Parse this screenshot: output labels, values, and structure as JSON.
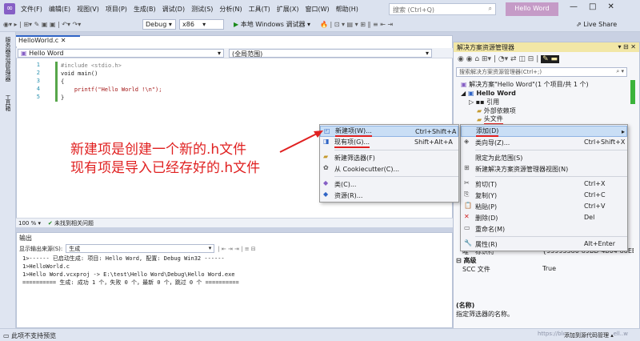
{
  "menu": [
    "文件(F)",
    "编辑(E)",
    "视图(V)",
    "项目(P)",
    "生成(B)",
    "调试(D)",
    "测试(S)",
    "分析(N)",
    "工具(T)",
    "扩展(X)",
    "窗口(W)",
    "帮助(H)"
  ],
  "search_placeholder": "搜索 (Ctrl+Q)",
  "app_title": "Hello Word",
  "live_share": "Live Share",
  "toolbar": {
    "config": "Debug",
    "platform": "x86",
    "run": "本地 Windows 调试器"
  },
  "left_strip": [
    "服务器资源管理器",
    "工具箱"
  ],
  "editor": {
    "tab": "HelloWorld.c",
    "scope_left": "Hello Word",
    "scope_right": "(全局范围)",
    "lines": [
      {
        "n": "1",
        "t": "#include <stdio.h>"
      },
      {
        "n": "2",
        "t": "void main()"
      },
      {
        "n": "3",
        "t": "{"
      },
      {
        "n": "4",
        "t": "    printf(\"Hello World !\\n\");"
      },
      {
        "n": "5",
        "t": "}"
      }
    ],
    "zoom": "100 %",
    "issues": "未找到相关问题"
  },
  "output": {
    "title": "输出",
    "source_label": "显示输出来源(S):",
    "source": "生成",
    "lines": [
      "1>------ 已启动生成: 项目: Hello Word, 配置: Debug Win32 ------",
      "1>HelloWorld.c",
      "1>Hello Word.vcxproj -> E:\\test\\Hello Word\\Debug\\Hello Word.exe",
      "========== 生成: 成功 1 个，失败 0 个，最新 0 个，跳过 0 个 =========="
    ]
  },
  "solution_explorer": {
    "title": "解决方案资源管理器",
    "search": "搜索解决方案资源管理器(Ctrl+;)",
    "items": [
      "解决方案\"Hello Word\"(1 个项目/共 1 个)",
      "Hello Word",
      "引用",
      "外部依赖项",
      "头文件"
    ]
  },
  "properties": {
    "rows": [
      {
        "k": "唯一标识符",
        "v": "{93995380-89BD-4b04-88EB-6"
      }
    ],
    "group": "高级",
    "scc_key": "SCC 文件",
    "scc_val": "True",
    "desc_title": "(名称)",
    "desc": "指定筛选器的名称。"
  },
  "context_menu": [
    {
      "label": "添加(D)",
      "shortcut": "",
      "arrow": "▸"
    },
    {
      "label": "类向导(Z)...",
      "shortcut": "Ctrl+Shift+X"
    },
    {
      "label": "限定为此范围(S)",
      "shortcut": ""
    },
    {
      "label": "新建解决方案资源管理器视图(N)",
      "shortcut": ""
    },
    {
      "label": "剪切(T)",
      "shortcut": "Ctrl+X"
    },
    {
      "label": "复制(Y)",
      "shortcut": "Ctrl+C"
    },
    {
      "label": "粘贴(P)",
      "shortcut": "Ctrl+V"
    },
    {
      "label": "删除(D)",
      "shortcut": "Del"
    },
    {
      "label": "重命名(M)",
      "shortcut": ""
    },
    {
      "label": "属性(R)",
      "shortcut": "Alt+Enter"
    }
  ],
  "submenu": [
    {
      "label": "新建项(W)...",
      "shortcut": "Ctrl+Shift+A"
    },
    {
      "label": "现有项(G)...",
      "shortcut": "Shift+Alt+A"
    },
    {
      "label": "新建筛选器(F)",
      "shortcut": ""
    },
    {
      "label": "从 Cookiecutter(C)...",
      "shortcut": ""
    },
    {
      "label": "类(C)...",
      "shortcut": ""
    },
    {
      "label": "资源(R)...",
      "shortcut": ""
    }
  ],
  "annotation": [
    "新建项是创建一个新的.h文件",
    "现有项是导入已经存好的.h文件"
  ],
  "status": {
    "left": "此项不支持预览",
    "right": "添加到源代码管理 ▴",
    "watermark": "https://blog.csdn.net/Hanwell..w"
  },
  "colors": {
    "accent": "#2f64c5",
    "title_purple": "#c59bc7",
    "annot_red": "#e02020",
    "se_header": "#f2e7a6"
  }
}
